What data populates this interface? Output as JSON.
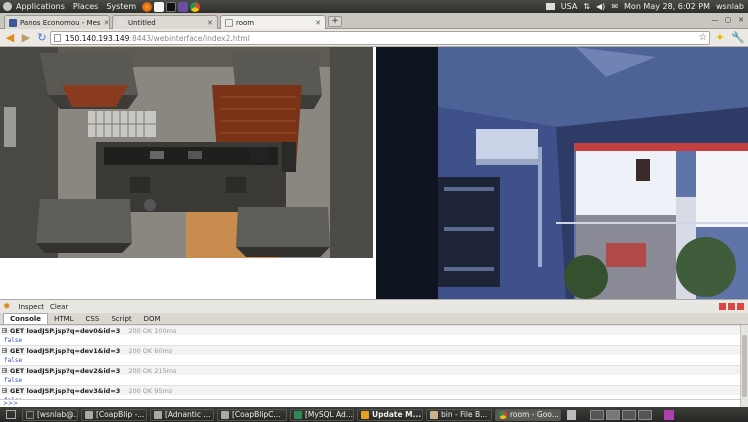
{
  "top_panel": {
    "menus": [
      "Applications",
      "Places",
      "System"
    ],
    "keyboard": "USA",
    "datetime": "Mon May 28,  6:02 PM",
    "user": "wsnlab"
  },
  "tabs": [
    {
      "label": "Panos Economou - Mes",
      "favicon_color": "#3b5998"
    },
    {
      "label": "Untitled",
      "favicon_color": "#dddddd"
    },
    {
      "label": "room",
      "favicon_color": "#eeeeee"
    }
  ],
  "address": {
    "host": "150.140.193.149",
    "rest": ":8443/webinterface/index2.html"
  },
  "firebug": {
    "toolbar": {
      "inspect": "Inspect",
      "clear": "Clear"
    },
    "tabs": [
      "Console",
      "HTML",
      "CSS",
      "Script",
      "DOM"
    ],
    "log": [
      {
        "request": "GET loadJSP.jsp?q=dev0&id=3",
        "status": "200 OK 100ms",
        "response": "false"
      },
      {
        "request": "GET loadJSP.jsp?q=dev1&id=3",
        "status": "200 OK 60ms",
        "response": "false"
      },
      {
        "request": "GET loadJSP.jsp?q=dev2&id=3",
        "status": "200 OK 215ms",
        "response": "false"
      },
      {
        "request": "GET loadJSP.jsp?q=dev3&id=3",
        "status": "200 OK 95ms",
        "response": "false"
      }
    ],
    "prompt": ">>>"
  },
  "taskbar": [
    {
      "label": "[wsnlab@...",
      "color": "#333333"
    },
    {
      "label": "[CoapBlip -...",
      "color": "#a9a9a9"
    },
    {
      "label": "[Adnantic ...",
      "color": "#a9a9a9"
    },
    {
      "label": "[CoapBlipC...",
      "color": "#a9a9a9"
    },
    {
      "label": "[MySQL Ad...",
      "color": "#2e8b57"
    },
    {
      "label": "Update M...",
      "color": "#e0a020"
    },
    {
      "label": "bin - File B...",
      "color": "#c9b38a"
    },
    {
      "label": "room - Goo...",
      "color": "#e8b84a"
    }
  ]
}
